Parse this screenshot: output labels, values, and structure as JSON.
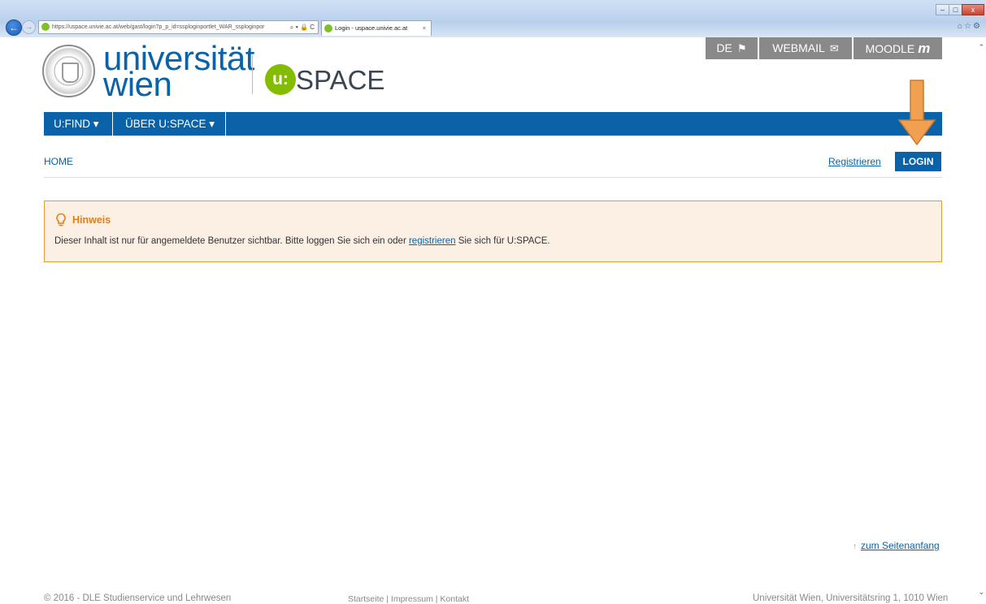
{
  "browser": {
    "url": "https://uspace.univie.ac.at/web/gast/login?p_p_id=ssploginportlet_WAR_ssploginpor",
    "address_tools": "⌕ ▾ 🔒 C",
    "tab_title": "Login - uspace.univie.ac.at",
    "tab_close": "×",
    "back_glyph": "←",
    "forward_glyph": "→",
    "window_minimize": "–",
    "window_maximize": "□",
    "window_close": "x",
    "toolbar_icons": "⌂☆⚙"
  },
  "header": {
    "logo_line1": "universität",
    "logo_line2": "wien",
    "uspace_u": "u:",
    "uspace_text": "SPACE",
    "top_links": [
      {
        "label": "DE",
        "icon": "flag-icon"
      },
      {
        "label": "WEBMAIL",
        "icon": "envelope-icon"
      },
      {
        "label": "MOODLE",
        "icon": "moodle-m-icon",
        "glyph": "m"
      }
    ]
  },
  "nav": {
    "items": [
      {
        "label": "U:FIND ▾"
      },
      {
        "label": "ÜBER U:SPACE ▾"
      }
    ]
  },
  "breadcrumb": {
    "home": "HOME"
  },
  "actions": {
    "register": "Registrieren",
    "login": "LOGIN"
  },
  "alert": {
    "title": "Hinweis",
    "text_before": "Dieser Inhalt ist nur für angemeldete Benutzer sichtbar. Bitte loggen Sie sich ein oder ",
    "link": "registrieren",
    "text_after": " Sie sich für U:SPACE."
  },
  "footer": {
    "to_top_arrow": "↑",
    "to_top": "zum Seitenanfang",
    "copyright": "© 2016 - DLE Studienservice und Lehrwesen",
    "links": "Startseite | Impressum | Kontakt",
    "address": "Universität Wien, Universitätsring 1, 1010 Wien"
  },
  "colors": {
    "primary_blue": "#0a62a8",
    "uspace_green": "#84bd00",
    "alert_border": "#e39a3b",
    "alert_bg": "#fcefe4",
    "annotation_arrow": "#f0a050",
    "top_link_grey": "#898989"
  }
}
